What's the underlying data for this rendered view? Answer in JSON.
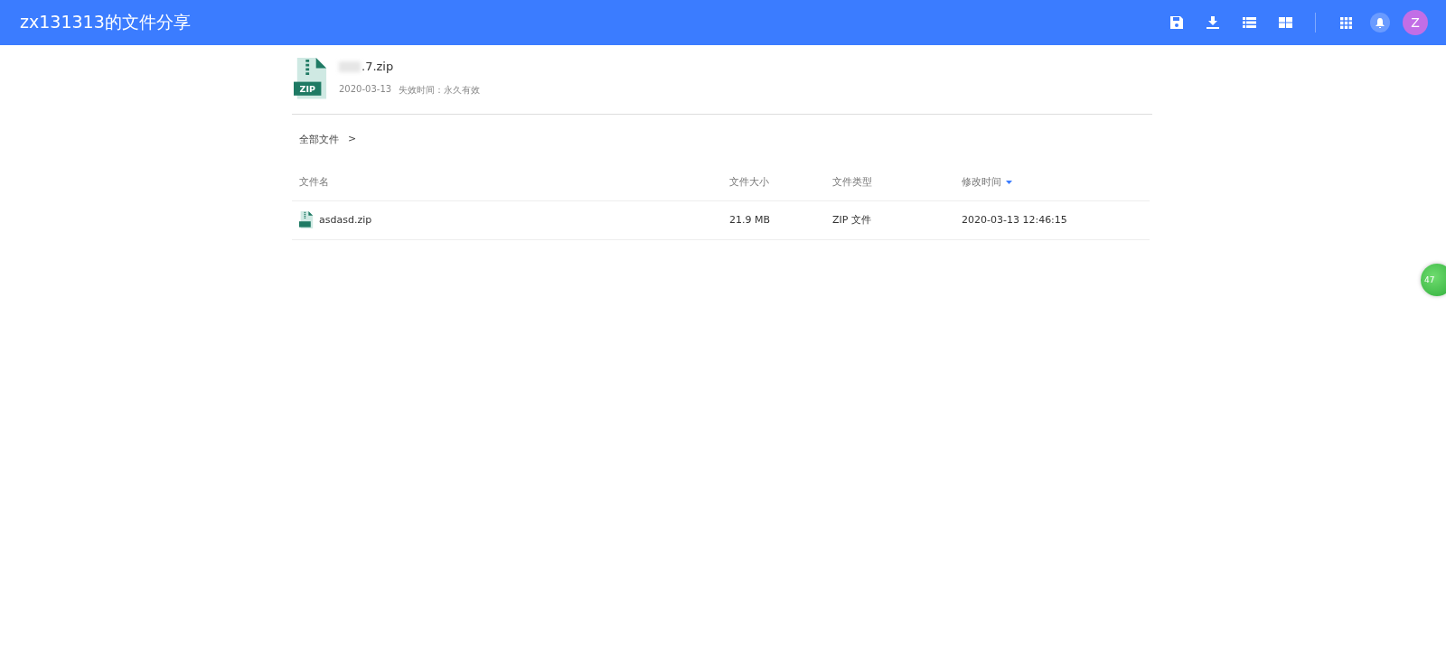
{
  "header": {
    "title": "zx131313的文件分享",
    "avatar": "Z"
  },
  "share": {
    "icon_label": "ZIP",
    "file_name": ".7.zip",
    "date": "2020-03-13",
    "expiry": "失效时间：永久有效"
  },
  "breadcrumb": {
    "items": [
      "全部文件"
    ],
    "separator": ">"
  },
  "table": {
    "columns": [
      {
        "label": "文件名",
        "sorted": false
      },
      {
        "label": "文件大小",
        "sorted": false
      },
      {
        "label": "文件类型",
        "sorted": false
      },
      {
        "label": "修改时间",
        "sorted": true
      }
    ],
    "rows": [
      {
        "name": "asdasd.zip",
        "size": "21.9 MB",
        "type": "ZIP 文件",
        "modified": "2020-03-13 12:46:15"
      }
    ]
  },
  "float_badge": {
    "label": "47"
  }
}
